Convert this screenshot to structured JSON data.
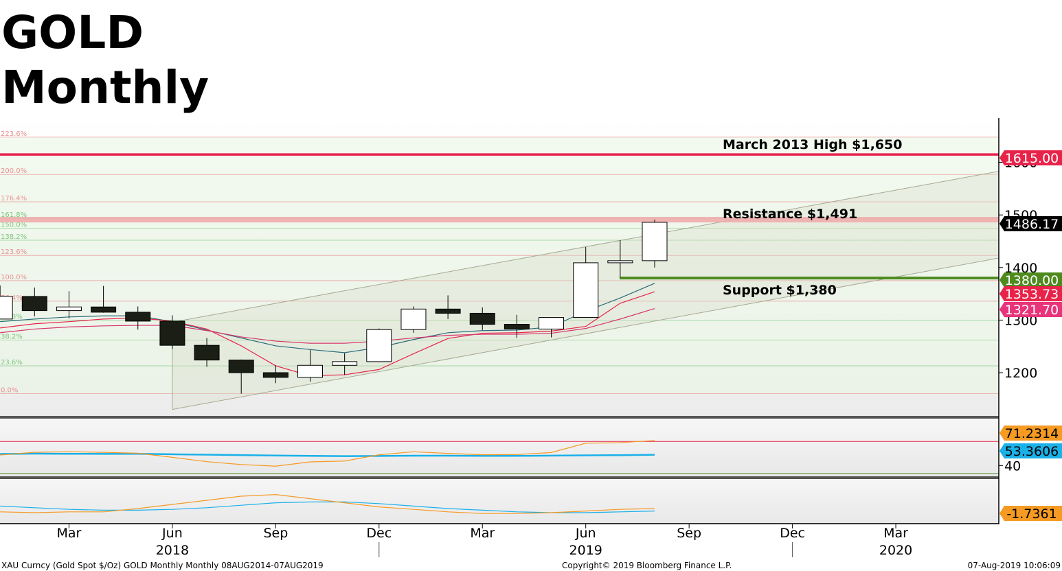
{
  "title": {
    "line1": "GOLD",
    "line2": "Monthly"
  },
  "annotations": {
    "march_high": "March 2013 High $1,650",
    "resistance": "Resistance $1,491",
    "support": "Support $1,380"
  },
  "price_tags": [
    {
      "text": "1615.00",
      "value": 1615,
      "bg": "#e8234a",
      "fg": "#ffffff"
    },
    {
      "text": "1486.17",
      "value": 1486.17,
      "bg": "#000000",
      "fg": "#ffffff"
    },
    {
      "text": "1380.00",
      "value": 1380,
      "bg": "#4e8a1e",
      "fg": "#ffffff"
    },
    {
      "text": "1353.73",
      "value": 1353.73,
      "bg": "#e8234a",
      "fg": "#ffffff"
    },
    {
      "text": "1321.70",
      "value": 1321.7,
      "bg": "#e8347a",
      "fg": "#ffffff"
    }
  ],
  "rsi_tags": [
    {
      "text": "71.2314",
      "value": 71.2314,
      "bg": "#f59a23",
      "fg": "#000000"
    },
    {
      "text": "53.3606",
      "value": 53.3606,
      "bg": "#1ab0e8",
      "fg": "#000000"
    }
  ],
  "macd_tag": {
    "text": "-1.7361",
    "bg": "#f59a23",
    "fg": "#000000"
  },
  "fib_labels": [
    {
      "text": "223.6%",
      "value": 1648,
      "color": "#e89090"
    },
    {
      "text": "200.0%",
      "value": 1577,
      "color": "#e89090"
    },
    {
      "text": "176.4%",
      "value": 1525,
      "color": "#e89090"
    },
    {
      "text": "161.8%",
      "value": 1494,
      "color": "#7ac77a"
    },
    {
      "text": "150.0%",
      "value": 1475,
      "color": "#7ac77a"
    },
    {
      "text": "138.2%",
      "value": 1452,
      "color": "#7ac77a"
    },
    {
      "text": "123.6%",
      "value": 1423,
      "color": "#e89090"
    },
    {
      "text": "100.0%",
      "value": 1375,
      "color": "#e89090"
    },
    {
      "text": "76.4%",
      "value": 1336,
      "color": "#e89090"
    },
    {
      "text": "61.8%",
      "value": 1300,
      "color": "#7ac77a"
    },
    {
      "text": "38.2%",
      "value": 1262,
      "color": "#7ac77a"
    },
    {
      "text": "23.6%",
      "value": 1213,
      "color": "#7ac77a"
    },
    {
      "text": "0.0%",
      "value": 1160,
      "color": "#e89090"
    }
  ],
  "x_axis": {
    "months": [
      "Mar",
      "Jun",
      "Sep",
      "Dec",
      "Mar",
      "Jun",
      "Sep",
      "Dec",
      "Mar"
    ],
    "years": [
      "2018",
      "2019",
      "2020"
    ]
  },
  "footer": {
    "left": "XAU Curncy (Gold Spot   $/Oz) GOLD Monthly  Monthly 08AUG2014-07AUG2019",
    "center": "Copyright© 2019 Bloomberg Finance L.P.",
    "right": "07-Aug-2019 10:06:09"
  },
  "colors": {
    "resistance_band": "#f0a8a8",
    "high_line": "#e8234a",
    "support_line": "#4e8a1e",
    "channel": "#a8a890",
    "ma_fast": "#e8234a",
    "ma_mid": "#d8346a",
    "ma_slow": "#2a6a7a",
    "rsi_line": "#f59a23",
    "rsi_ma": "#1ab0e8"
  },
  "chart_data": {
    "type": "candlestick",
    "title": "GOLD Monthly",
    "interval": "monthly",
    "y_ticks": [
      1200,
      1300,
      1400,
      1500,
      1600
    ],
    "y_range": [
      1130,
      1680
    ],
    "candles": [
      {
        "date": "2018-01",
        "open": 1302,
        "high": 1366,
        "close": 1345,
        "low": 1302
      },
      {
        "date": "2018-02",
        "open": 1345,
        "high": 1362,
        "close": 1318,
        "low": 1307
      },
      {
        "date": "2018-03",
        "open": 1318,
        "high": 1355,
        "close": 1325,
        "low": 1303
      },
      {
        "date": "2018-04",
        "open": 1325,
        "high": 1365,
        "close": 1315,
        "low": 1314
      },
      {
        "date": "2018-05",
        "open": 1315,
        "high": 1326,
        "close": 1298,
        "low": 1282
      },
      {
        "date": "2018-06",
        "open": 1298,
        "high": 1309,
        "close": 1252,
        "low": 1245
      },
      {
        "date": "2018-07",
        "open": 1252,
        "high": 1266,
        "close": 1224,
        "low": 1211
      },
      {
        "date": "2018-08",
        "open": 1224,
        "high": 1225,
        "close": 1200,
        "low": 1160
      },
      {
        "date": "2018-09",
        "open": 1200,
        "high": 1214,
        "close": 1191,
        "low": 1180
      },
      {
        "date": "2018-10",
        "open": 1191,
        "high": 1243,
        "close": 1214,
        "low": 1183
      },
      {
        "date": "2018-11",
        "open": 1214,
        "high": 1237,
        "close": 1221,
        "low": 1196
      },
      {
        "date": "2018-12",
        "open": 1221,
        "high": 1284,
        "close": 1282,
        "low": 1221
      },
      {
        "date": "2019-01",
        "open": 1282,
        "high": 1326,
        "close": 1321,
        "low": 1276
      },
      {
        "date": "2019-02",
        "open": 1321,
        "high": 1347,
        "close": 1313,
        "low": 1302
      },
      {
        "date": "2019-03",
        "open": 1313,
        "high": 1324,
        "close": 1292,
        "low": 1281
      },
      {
        "date": "2019-04",
        "open": 1292,
        "high": 1310,
        "close": 1283,
        "low": 1266
      },
      {
        "date": "2019-05",
        "open": 1283,
        "high": 1305,
        "close": 1305,
        "low": 1267
      },
      {
        "date": "2019-06",
        "open": 1305,
        "high": 1439,
        "close": 1409,
        "low": 1305
      },
      {
        "date": "2019-07",
        "open": 1409,
        "high": 1452,
        "close": 1413,
        "low": 1381
      },
      {
        "date": "2019-08",
        "open": 1413,
        "high": 1491,
        "close": 1486,
        "low": 1400
      }
    ],
    "moving_averages": [
      {
        "color": "#2a6a7a",
        "values": [
          1297,
          1302,
          1306,
          1308,
          1308,
          1297,
          1281,
          1266,
          1251,
          1244,
          1238,
          1248,
          1263,
          1276,
          1280,
          1281,
          1287,
          1317,
          1342,
          1370
        ]
      },
      {
        "color": "#e8234a",
        "values": [
          1285,
          1293,
          1297,
          1302,
          1304,
          1298,
          1283,
          1251,
          1213,
          1194,
          1196,
          1206,
          1236,
          1265,
          1275,
          1276,
          1279,
          1288,
          1332,
          1354
        ]
      },
      {
        "color": "#d8346a",
        "values": [
          1276,
          1283,
          1287,
          1289,
          1290,
          1290,
          1280,
          1268,
          1260,
          1256,
          1256,
          1260,
          1266,
          1271,
          1273,
          1273,
          1275,
          1284,
          1302,
          1322
        ]
      }
    ],
    "horizontal_levels": [
      {
        "value": 1615,
        "label": "March 2013 High $1,650"
      },
      {
        "value": 1491,
        "label": "Resistance $1,491"
      },
      {
        "value": 1380,
        "label": "Support $1,380"
      }
    ],
    "rsi": {
      "y_range": [
        30,
        80
      ],
      "y_ticks": [
        40
      ],
      "upper_level": 70,
      "lower_level": 30,
      "rsi_values": [
        53.1,
        56.5,
        57.2,
        56.4,
        55.3,
        50.2,
        44.8,
        41.2,
        39.2,
        44.5,
        45.6,
        53.4,
        57.1,
        55.1,
        53.4,
        53.7,
        56.2,
        67.8,
        68.5,
        71.2
      ],
      "ma_values": [
        54.4,
        54.8,
        54.6,
        54.5,
        54.6,
        54.0,
        53.5,
        53.0,
        52.4,
        52.0,
        51.7,
        51.9,
        52.2,
        52.2,
        52.0,
        52.0,
        52.3,
        52.6,
        52.9,
        53.4
      ]
    },
    "macd": {
      "orange": [
        -9,
        -10,
        -9,
        -9,
        -5,
        0,
        5,
        10,
        12,
        7,
        2,
        -3,
        -6,
        -9,
        -11,
        -11,
        -10,
        -8,
        -6,
        -5
      ],
      "blue": [
        -2,
        -4,
        -6,
        -7,
        -7,
        -6,
        -4,
        -1,
        2,
        3,
        3,
        1,
        -2,
        -5,
        -7,
        -9,
        -10,
        -10,
        -9,
        -8
      ]
    }
  }
}
